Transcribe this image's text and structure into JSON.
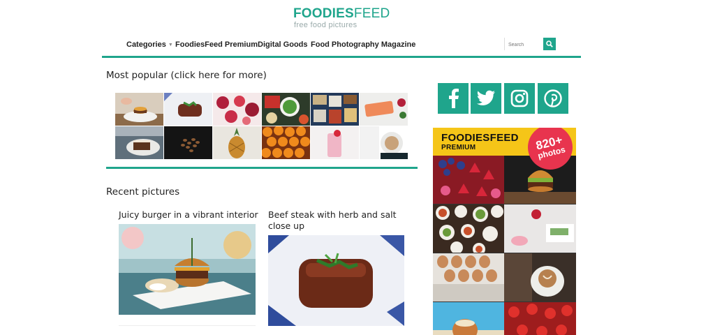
{
  "site": {
    "logo_bold": "FOODIES",
    "logo_light": "FEED",
    "tagline": "free food pictures"
  },
  "nav": {
    "items": [
      {
        "label": "Categories",
        "has_dropdown": true
      },
      {
        "label": "FoodiesFeed Premium"
      },
      {
        "label": "Digital Goods"
      },
      {
        "label": "Food Photography Magazine"
      }
    ],
    "search_placeholder": "Search"
  },
  "colors": {
    "accent": "#1fa58c",
    "premium_yellow": "#f5c518",
    "badge_red": "#e8344e"
  },
  "popular": {
    "title": "Most popular (click here for more)",
    "thumbs": [
      {
        "subject": "burger on plate"
      },
      {
        "subject": "steak with herbs"
      },
      {
        "subject": "pomegranate and fruits"
      },
      {
        "subject": "salad bowls"
      },
      {
        "subject": "table of dishes"
      },
      {
        "subject": "salmon fillet"
      },
      {
        "subject": "chocolate cake slice"
      },
      {
        "subject": "coffee beans"
      },
      {
        "subject": "pineapple"
      },
      {
        "subject": "tangerines"
      },
      {
        "subject": "strawberry smoothie"
      },
      {
        "subject": "coffee cup"
      }
    ]
  },
  "recent": {
    "title": "Recent pictures",
    "posts": [
      {
        "title": "Juicy burger in a vibrant interior"
      },
      {
        "title": "Beef steak with herb and salt close up"
      }
    ]
  },
  "social": [
    {
      "icon": "facebook-icon"
    },
    {
      "icon": "twitter-icon"
    },
    {
      "icon": "instagram-icon"
    },
    {
      "icon": "pinterest-icon"
    }
  ],
  "premium": {
    "title": "FOODIESFEED",
    "subtitle": "PREMIUM",
    "badge_count": "820+",
    "badge_label": "photos"
  }
}
